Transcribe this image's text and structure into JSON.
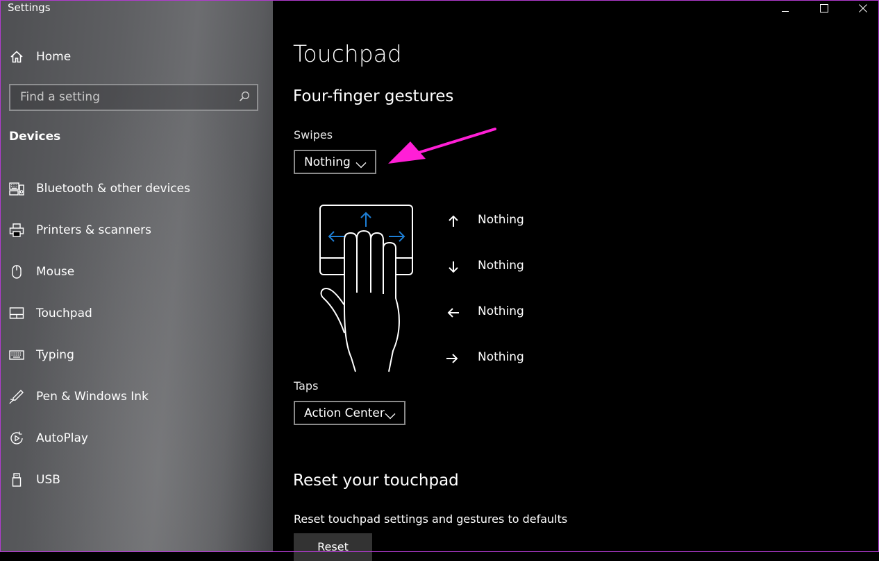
{
  "window": {
    "title": "Settings"
  },
  "sidebar": {
    "home_label": "Home",
    "search_placeholder": "Find a setting",
    "section": "Devices",
    "items": [
      {
        "label": "Bluetooth & other devices",
        "icon": "bluetooth-devices-icon"
      },
      {
        "label": "Printers & scanners",
        "icon": "printer-icon"
      },
      {
        "label": "Mouse",
        "icon": "mouse-icon"
      },
      {
        "label": "Touchpad",
        "icon": "touchpad-icon"
      },
      {
        "label": "Typing",
        "icon": "keyboard-icon"
      },
      {
        "label": "Pen & Windows Ink",
        "icon": "pen-icon"
      },
      {
        "label": "AutoPlay",
        "icon": "autoplay-icon"
      },
      {
        "label": "USB",
        "icon": "usb-icon"
      }
    ]
  },
  "main": {
    "title": "Touchpad",
    "section_title": "Four-finger gestures",
    "swipes": {
      "label": "Swipes",
      "value": "Nothing"
    },
    "gestures": [
      {
        "direction": "up",
        "value": "Nothing"
      },
      {
        "direction": "down",
        "value": "Nothing"
      },
      {
        "direction": "left",
        "value": "Nothing"
      },
      {
        "direction": "right",
        "value": "Nothing"
      }
    ],
    "taps": {
      "label": "Taps",
      "value": "Action Center"
    },
    "reset": {
      "title": "Reset your touchpad",
      "description": "Reset touchpad settings and gestures to defaults",
      "button_label": "Reset"
    }
  },
  "colors": {
    "annotation_arrow": "#ff1fd6",
    "gesture_accent": "#1e7fd6",
    "sidebar": "#5e5f62",
    "background": "#000000"
  }
}
